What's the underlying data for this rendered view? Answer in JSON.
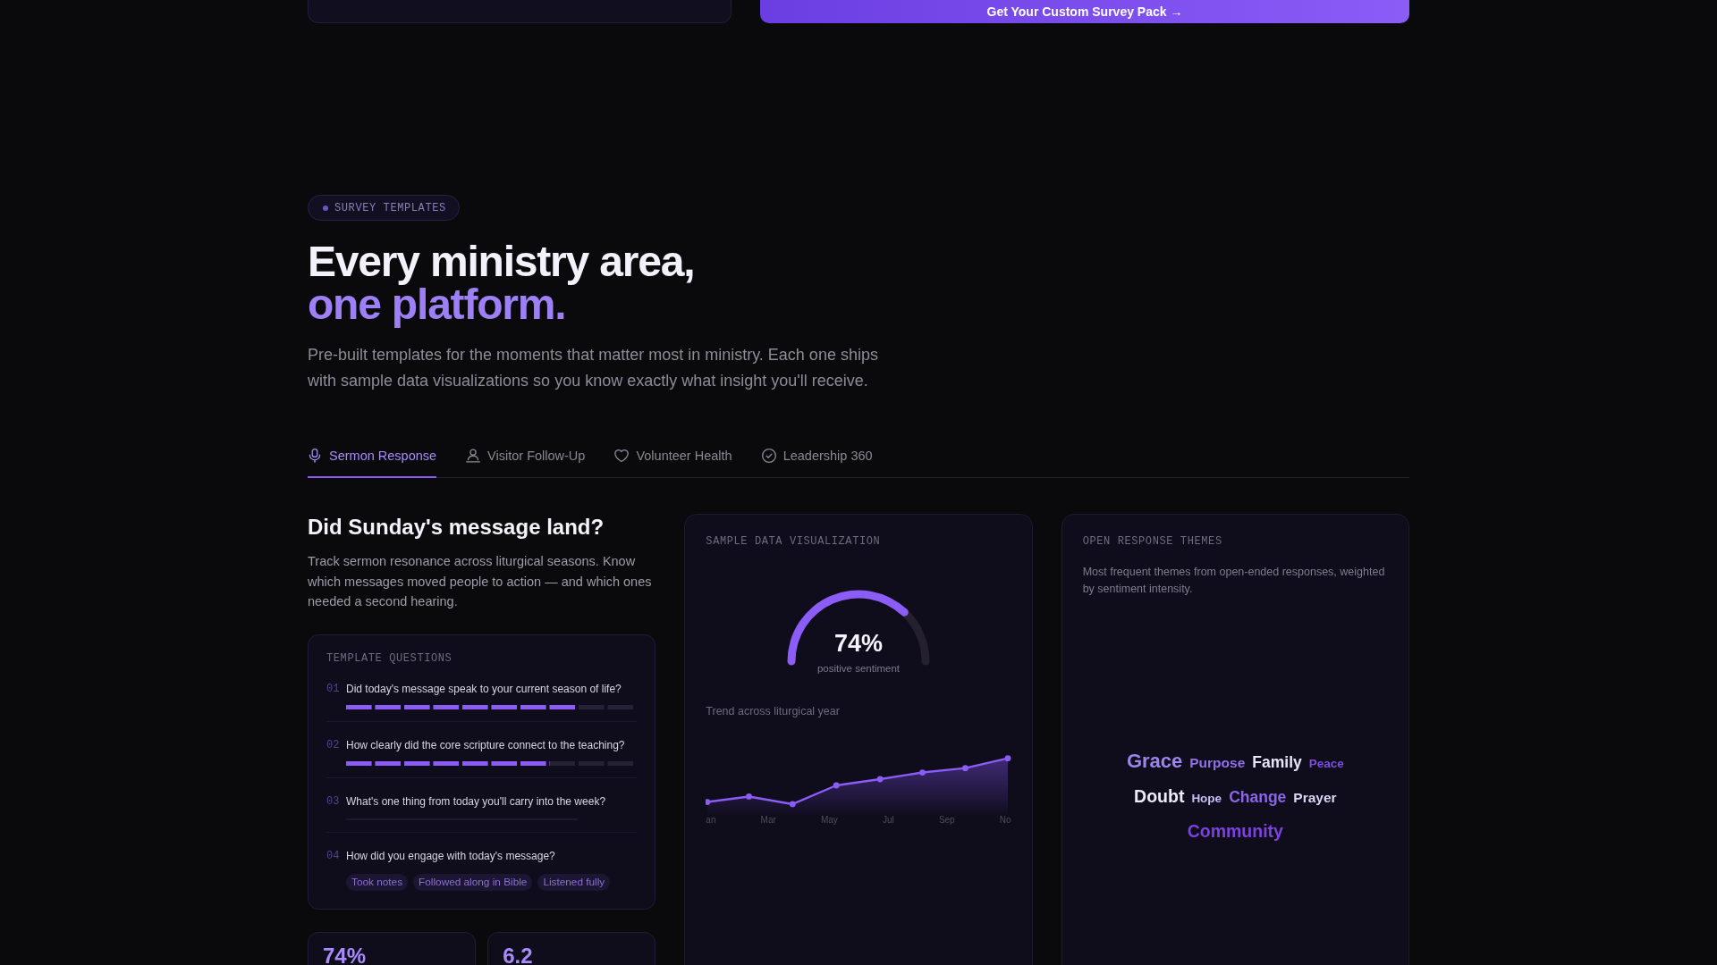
{
  "top_bar": {
    "cta_label": "Get Your Custom Survey Pack →"
  },
  "section": {
    "badge": "SURVEY TEMPLATES",
    "title_line_1": "Every ministry area,",
    "title_line_2": "one platform.",
    "intro": "Pre-built templates for the moments that matter most in ministry. Each one ships with sample data visualizations so you know exactly what insight you'll receive."
  },
  "tabs": [
    {
      "label": "Sermon Response",
      "selected": true
    },
    {
      "label": "Visitor Follow-Up",
      "selected": false
    },
    {
      "label": "Volunteer Health",
      "selected": false
    },
    {
      "label": "Leadership 360",
      "selected": false
    }
  ],
  "template": {
    "title": "Did Sunday's message land?",
    "description": "Track sermon resonance across liturgical seasons. Know which messages moved people to action — and which ones needed a second hearing.",
    "questions_heading": "TEMPLATE QUESTIONS",
    "questions": [
      {
        "number": "01",
        "text": "Did today's message speak to your current season of life?",
        "kind": "scale",
        "level": 0.8
      },
      {
        "number": "02",
        "text": "How clearly did the core scripture connect to the teaching?",
        "kind": "scale",
        "level": 0.7
      },
      {
        "number": "03",
        "text": "What's one thing from today you'll carry into the week?",
        "kind": "text"
      },
      {
        "number": "04",
        "text": "How did you engage with today's message?",
        "kind": "choice",
        "options": [
          "Took notes",
          "Followed along in Bible",
          "Listened fully"
        ]
      }
    ],
    "stats": [
      {
        "value": "74%"
      },
      {
        "value": "6.2"
      }
    ]
  },
  "visualization": {
    "heading": "SAMPLE DATA VISUALIZATION",
    "gauge": {
      "chart_data": {
        "type": "donut",
        "values": [
          74,
          26
        ],
        "colors": [
          "#8b5cf6",
          "#24202f"
        ]
      },
      "reading": "74%",
      "caption": "positive sentiment"
    },
    "trend": {
      "title": "Trend across liturgical year",
      "axis_labels": [
        "an",
        "Mar",
        "May",
        "Jul",
        "Sep",
        "No"
      ]
    }
  },
  "themes": {
    "heading": "OPEN RESPONSE THEMES",
    "description": "Most frequent themes from open-ended responses, weighted by sentiment intensity.",
    "rows": [
      {
        "words": [
          {
            "text": "Grace",
            "kind": "huge",
            "color": "#9d84ee"
          },
          {
            "text": "Purpose",
            "kind": "small",
            "color": "#9170ea"
          },
          {
            "text": "Family",
            "kind": "medium",
            "color": "#e8e4f6"
          },
          {
            "text": "Peace",
            "kind": "tiny",
            "color": "#7d4fdc"
          }
        ]
      },
      {
        "words": [
          {
            "text": "Doubt",
            "kind": "large",
            "color": "#eeeaf9"
          },
          {
            "text": "Hope",
            "kind": "tiny",
            "color": "#c8bcf4"
          },
          {
            "text": "Change",
            "kind": "medium",
            "color": "#8c66e8"
          },
          {
            "text": "Prayer",
            "kind": "small",
            "color": "#ddd5f5"
          }
        ]
      },
      {
        "words": [
          {
            "text": "Community",
            "kind": "large",
            "color": "#7b42dd"
          }
        ]
      }
    ]
  }
}
